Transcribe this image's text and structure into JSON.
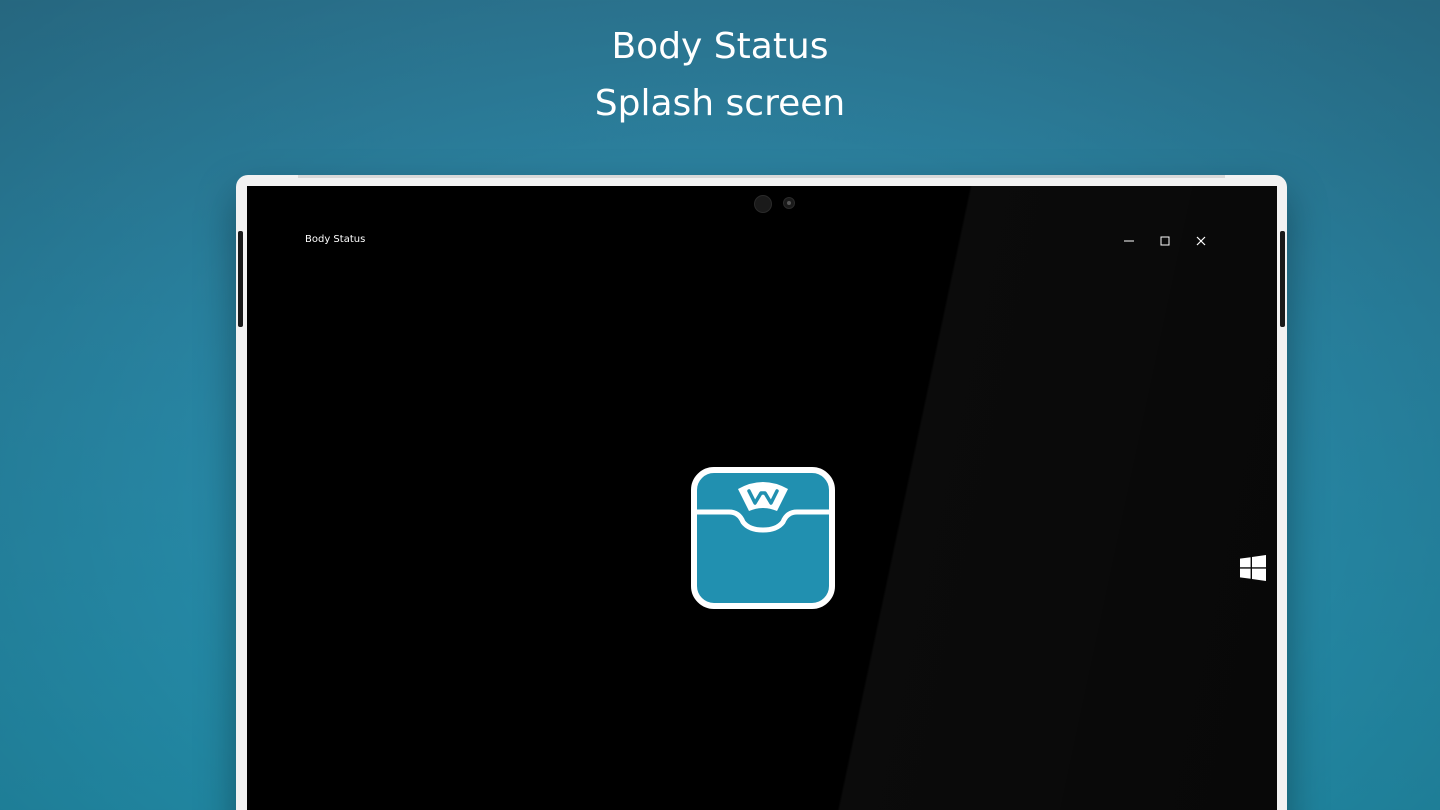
{
  "caption": {
    "line1": "Body Status",
    "line2": "Splash screen"
  },
  "window": {
    "title": "Body Status",
    "controls": [
      {
        "name": "minimize",
        "icon": "minimize-icon"
      },
      {
        "name": "maximize",
        "icon": "maximize-icon"
      },
      {
        "name": "close",
        "icon": "close-icon"
      }
    ]
  },
  "splash": {
    "logo_icon": "bathroom-scale-icon",
    "logo_color": "#2190b0",
    "background": "#000000"
  },
  "device": {
    "hardware_button_icon": "windows-logo-icon"
  },
  "colors": {
    "backdrop_top": "#2e7d9b",
    "backdrop_bottom": "#2391ae",
    "accent": "#2190b0"
  }
}
